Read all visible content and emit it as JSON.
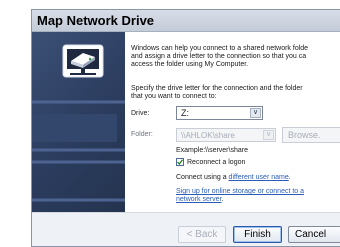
{
  "window": {
    "title": "Map Network Drive"
  },
  "content": {
    "intro_lines": [
      "Windows can help you connect to a shared network folde",
      "and assign a drive letter to the connection so that you ca",
      "access the folder using My Computer."
    ],
    "prompt_lines": [
      "Specify the drive letter for the connection and the folder",
      "that you want to connect to:"
    ],
    "drive": {
      "label": "Drive:",
      "value": "Z:"
    },
    "folder": {
      "label": "Folder:",
      "value": "\\\\AHLOK\\share",
      "browse_label": "Browse."
    },
    "example": "Example:\\\\server\\share",
    "reconnect": {
      "label": "Reconnect a logon",
      "checked": true
    },
    "connect_using": {
      "prefix": "Connect using a ",
      "link": "different user name",
      "suffix": "."
    },
    "signup": {
      "link_line1": "Sign up for online storage or connect to a",
      "link_line2": "network server",
      "suffix": "."
    }
  },
  "footer": {
    "back_label": "< Back",
    "finish_label": "Finish",
    "cancel_label": "Cancel"
  },
  "icons": {
    "panel_icon": "network-drive-icon",
    "check_icon": "checkmark-icon",
    "dropdown_icon": "chevron-down-icon"
  }
}
